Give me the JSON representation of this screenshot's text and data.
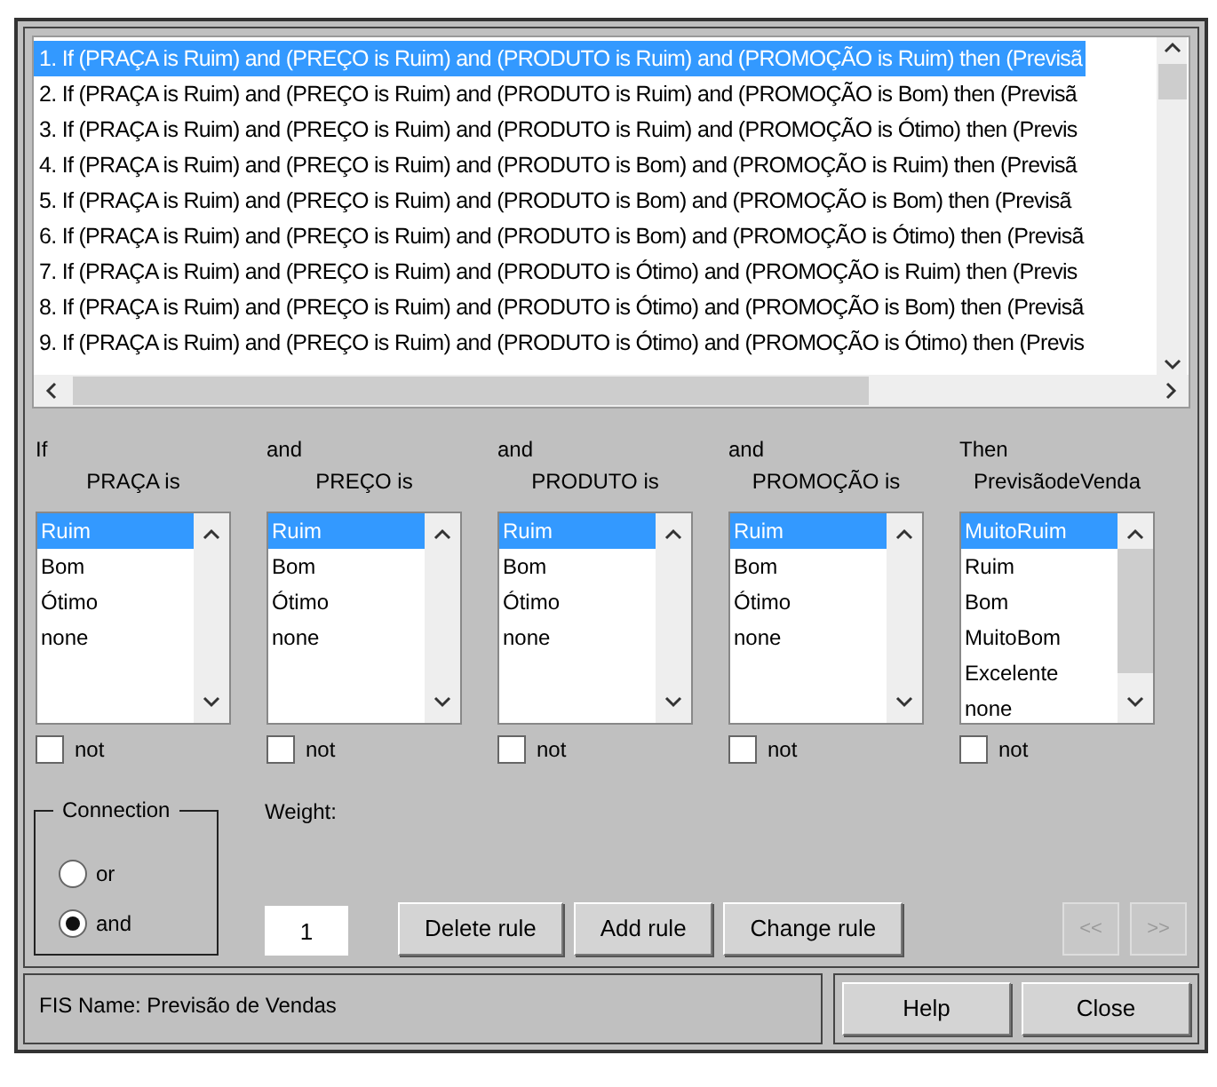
{
  "rules": [
    {
      "text": "1. If (PRAÇA is Ruim) and (PREÇO is Ruim) and (PRODUTO is Ruim) and (PROMOÇÃO is Ruim) then (Previsã",
      "selected": true
    },
    {
      "text": "2. If (PRAÇA is Ruim) and (PREÇO is Ruim) and (PRODUTO is Ruim) and (PROMOÇÃO is Bom) then (Previsã",
      "selected": false
    },
    {
      "text": "3. If (PRAÇA is Ruim) and (PREÇO is Ruim) and (PRODUTO is Ruim) and (PROMOÇÃO is Ótimo) then (Previs",
      "selected": false
    },
    {
      "text": "4. If (PRAÇA is Ruim) and (PREÇO is Ruim) and (PRODUTO is Bom) and (PROMOÇÃO is Ruim) then (Previsã",
      "selected": false
    },
    {
      "text": "5. If (PRAÇA is Ruim) and (PREÇO is Ruim) and (PRODUTO is Bom) and (PROMOÇÃO is Bom) then (Previsã",
      "selected": false
    },
    {
      "text": "6. If (PRAÇA is Ruim) and (PREÇO is Ruim) and (PRODUTO is Bom) and (PROMOÇÃO is Ótimo) then (Previsã",
      "selected": false
    },
    {
      "text": "7. If (PRAÇA is Ruim) and (PREÇO is Ruim) and (PRODUTO is Ótimo) and (PROMOÇÃO is Ruim) then (Previs",
      "selected": false
    },
    {
      "text": "8. If (PRAÇA is Ruim) and (PREÇO is Ruim) and (PRODUTO is Ótimo) and (PROMOÇÃO is Bom) then (Previsã",
      "selected": false
    },
    {
      "text": "9. If (PRAÇA is Ruim) and (PREÇO is Ruim) and (PRODUTO is Ótimo) and (PROMOÇÃO is Ótimo) then (Previs",
      "selected": false
    }
  ],
  "conditions": [
    {
      "connector": "If",
      "variable": "PRAÇA is",
      "options": [
        {
          "label": "Ruim",
          "selected": true
        },
        {
          "label": "Bom",
          "selected": false
        },
        {
          "label": "Ótimo",
          "selected": false
        },
        {
          "label": "none",
          "selected": false
        }
      ],
      "not_label": "not",
      "not": false
    },
    {
      "connector": "and",
      "variable": "PREÇO is",
      "options": [
        {
          "label": "Ruim",
          "selected": true
        },
        {
          "label": "Bom",
          "selected": false
        },
        {
          "label": "Ótimo",
          "selected": false
        },
        {
          "label": "none",
          "selected": false
        }
      ],
      "not_label": "not",
      "not": false
    },
    {
      "connector": "and",
      "variable": "PRODUTO is",
      "options": [
        {
          "label": "Ruim",
          "selected": true
        },
        {
          "label": "Bom",
          "selected": false
        },
        {
          "label": "Ótimo",
          "selected": false
        },
        {
          "label": "none",
          "selected": false
        }
      ],
      "not_label": "not",
      "not": false
    },
    {
      "connector": "and",
      "variable": "PROMOÇÃO is",
      "options": [
        {
          "label": "Ruim",
          "selected": true
        },
        {
          "label": "Bom",
          "selected": false
        },
        {
          "label": "Ótimo",
          "selected": false
        },
        {
          "label": "none",
          "selected": false
        }
      ],
      "not_label": "not",
      "not": false
    },
    {
      "connector": "Then",
      "variable": "PrevisãodeVenda",
      "options": [
        {
          "label": "MuitoRuim",
          "selected": true
        },
        {
          "label": "Ruim",
          "selected": false
        },
        {
          "label": "Bom",
          "selected": false
        },
        {
          "label": "MuitoBom",
          "selected": false
        },
        {
          "label": "Excelente",
          "selected": false
        },
        {
          "label": "none",
          "selected": false
        }
      ],
      "not_label": "not",
      "not": false
    }
  ],
  "connection": {
    "title": "Connection",
    "options": [
      {
        "label": "or",
        "selected": false
      },
      {
        "label": "and",
        "selected": true
      }
    ]
  },
  "weight": {
    "label": "Weight:",
    "value": "1"
  },
  "buttons": [
    "Delete rule",
    "Add rule",
    "Change rule"
  ],
  "nav": [
    {
      "label": "<<",
      "disabled": true
    },
    {
      "label": ">>",
      "disabled": true
    }
  ],
  "fis_name": "FIS Name: Previsão de Vendas",
  "footer_buttons": [
    "Help",
    "Close"
  ]
}
